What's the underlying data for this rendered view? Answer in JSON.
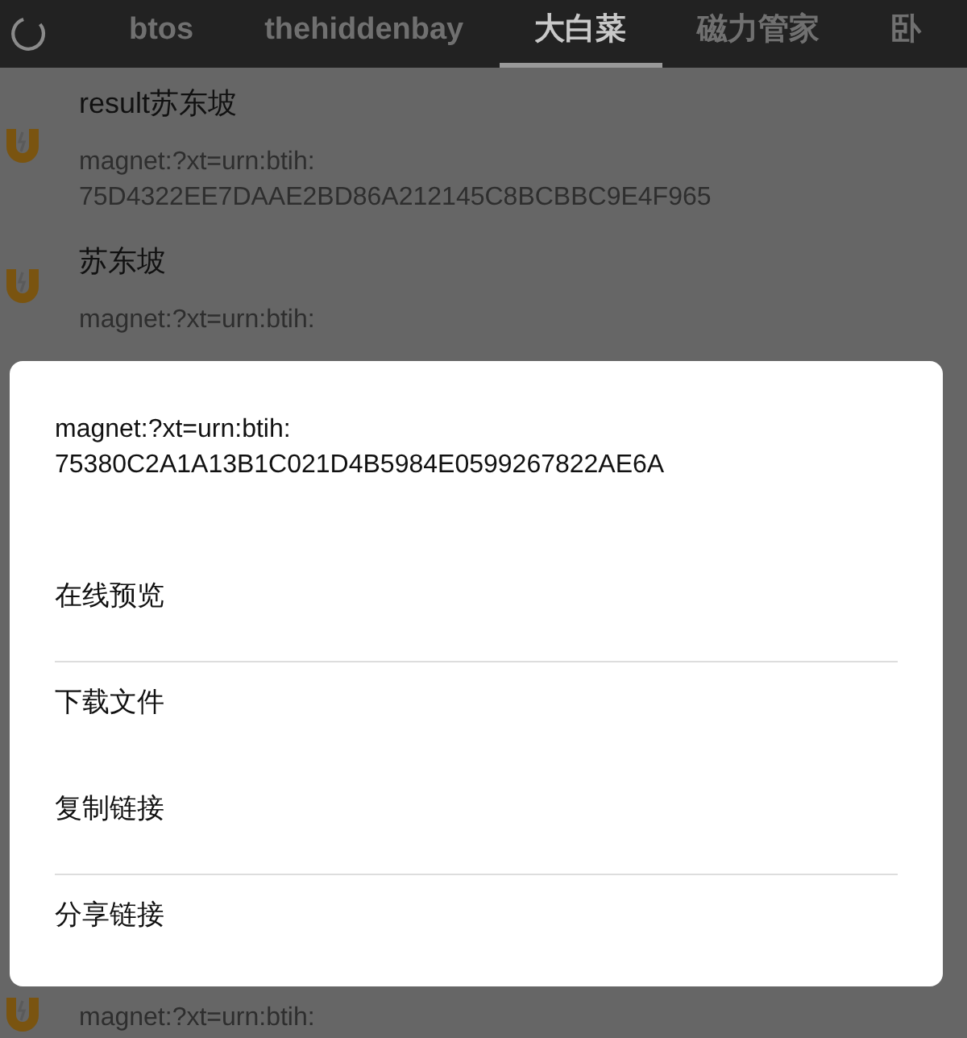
{
  "tabs": [
    {
      "label": "btos",
      "selected": false
    },
    {
      "label": "thehiddenbay",
      "selected": false
    },
    {
      "label": "大白菜",
      "selected": true
    },
    {
      "label": "磁力管家",
      "selected": false
    },
    {
      "label": "卧",
      "selected": false
    }
  ],
  "results": [
    {
      "title": "result苏东坡",
      "magnet": "magnet:?xt=urn:btih:\n75D4322EE7DAAE2BD86A212145C8BCBBC9E4F965"
    },
    {
      "title": "苏东坡",
      "magnet": "magnet:?xt=urn:btih:"
    },
    {
      "magnet": "magnet:?xt=urn:btih:"
    }
  ],
  "dialog": {
    "message": "magnet:?xt=urn:btih:\n75380C2A1A13B1C021D4B5984E0599267822AE6A",
    "items": [
      {
        "label": "在线预览",
        "divider_below": true
      },
      {
        "label": "下载文件",
        "divider_below": false
      },
      {
        "label": "复制链接",
        "divider_below": true
      },
      {
        "label": "分享链接",
        "divider_below": false
      }
    ]
  }
}
